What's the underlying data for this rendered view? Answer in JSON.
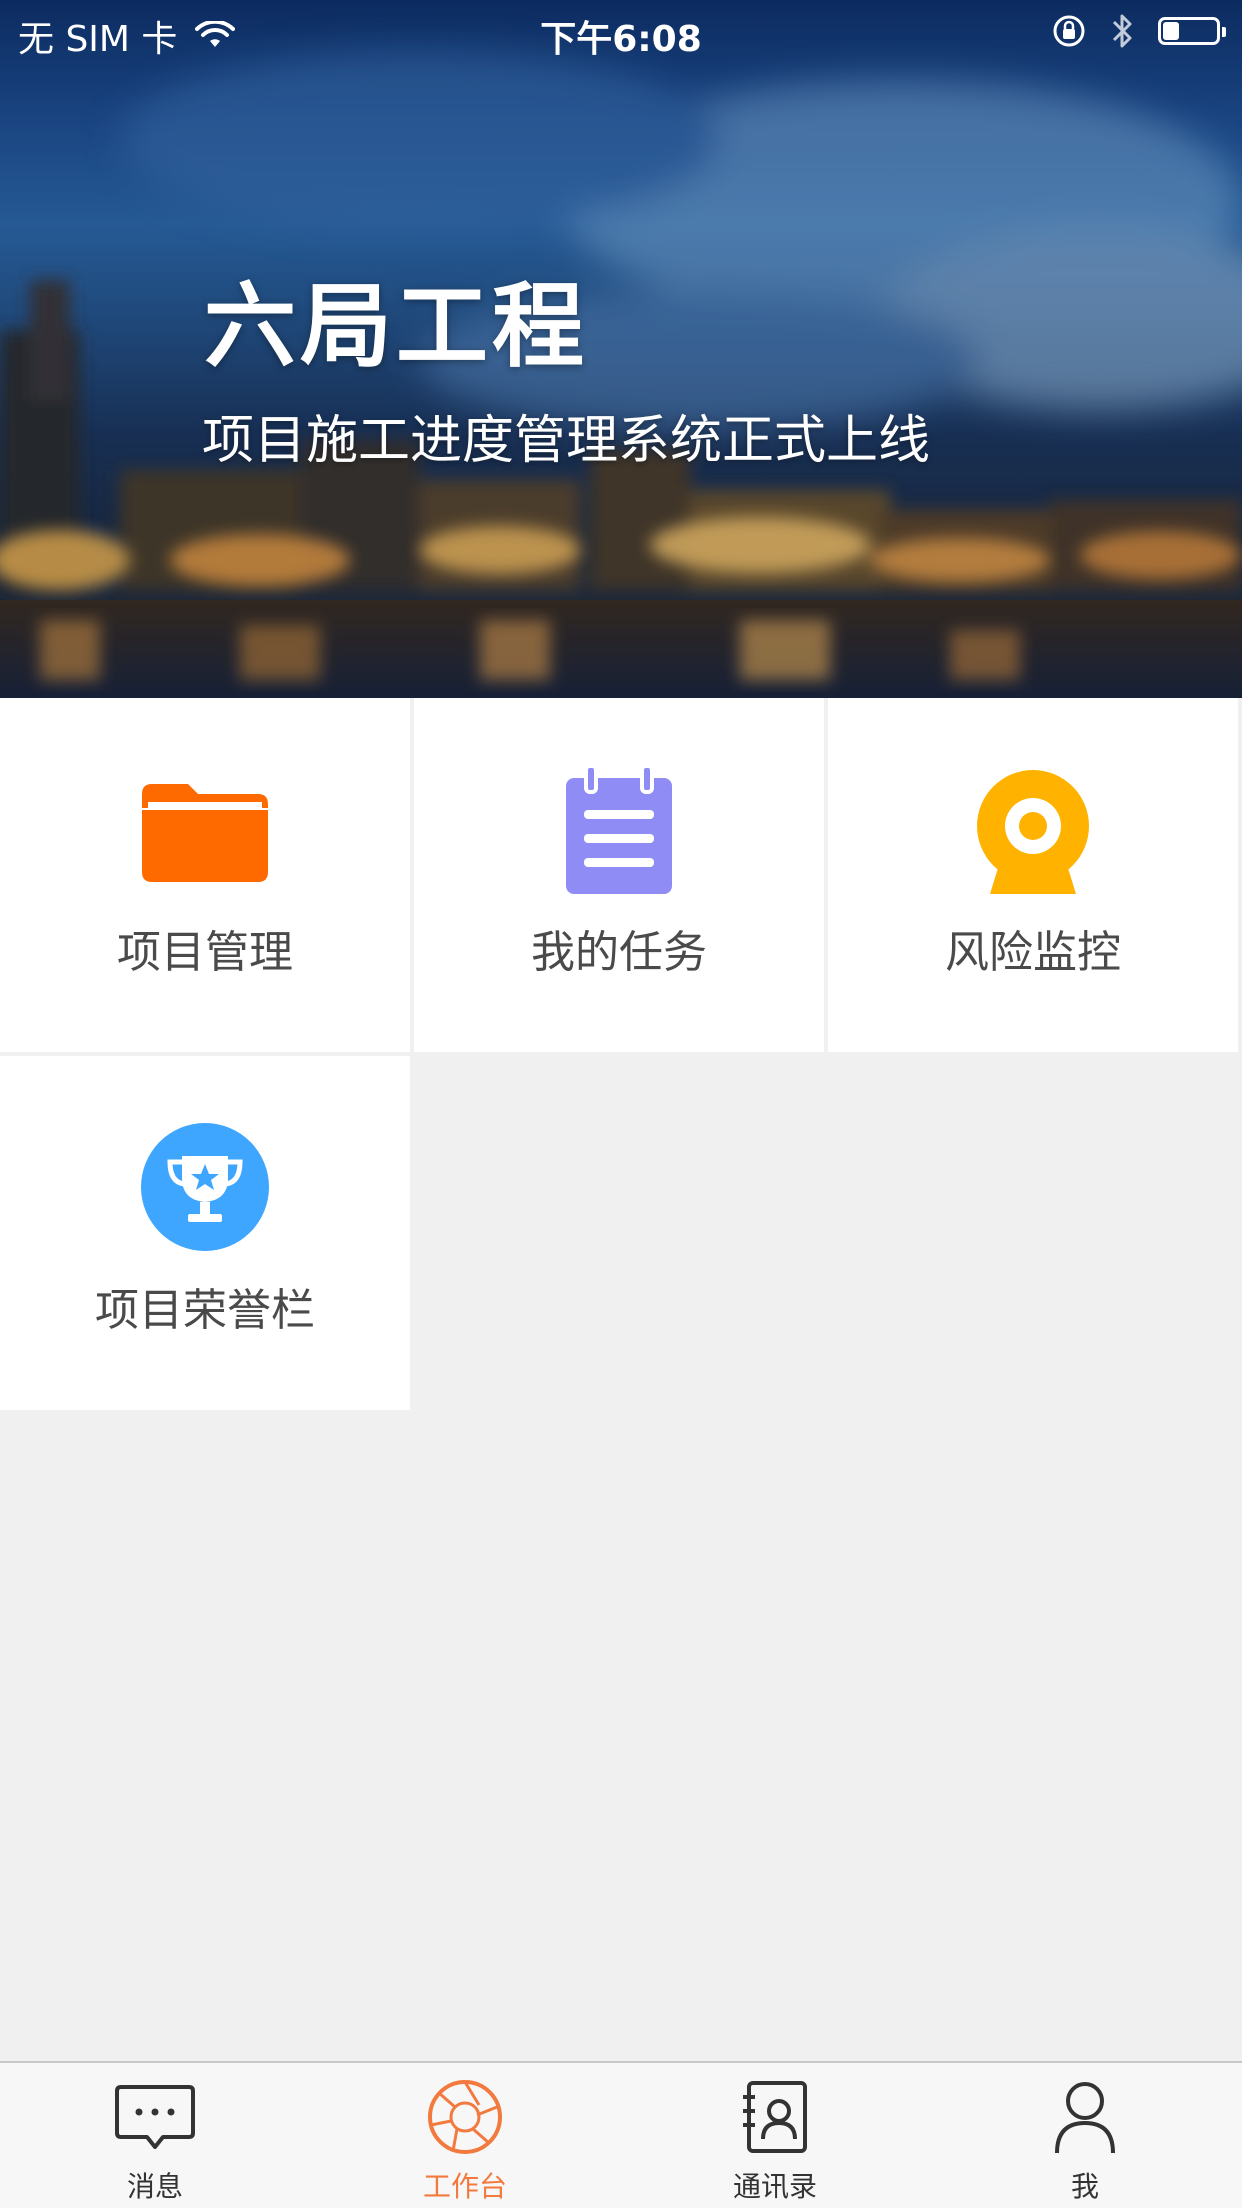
{
  "status_bar": {
    "carrier": "无 SIM 卡",
    "time": "下午6:08",
    "battery_level": 0.3
  },
  "banner": {
    "title": "六局工程",
    "subtitle": "项目施工进度管理系统正式上线"
  },
  "tiles": [
    {
      "label": "项目管理",
      "icon": "folder-icon",
      "color": "#ff6a00"
    },
    {
      "label": "我的任务",
      "icon": "notepad-icon",
      "color": "#8f8cf5"
    },
    {
      "label": "风险监控",
      "icon": "webcam-icon",
      "color": "#ffb300"
    },
    {
      "label": "项目荣誉栏",
      "icon": "trophy-icon",
      "color": "#3ea6ff"
    }
  ],
  "tabbar": {
    "active_color": "#f37a3f",
    "items": [
      {
        "label": "消息",
        "icon": "chat-bubble-icon",
        "active": false
      },
      {
        "label": "工作台",
        "icon": "aperture-icon",
        "active": true
      },
      {
        "label": "通讯录",
        "icon": "contacts-icon",
        "active": false
      },
      {
        "label": "我",
        "icon": "person-icon",
        "active": false
      }
    ]
  }
}
